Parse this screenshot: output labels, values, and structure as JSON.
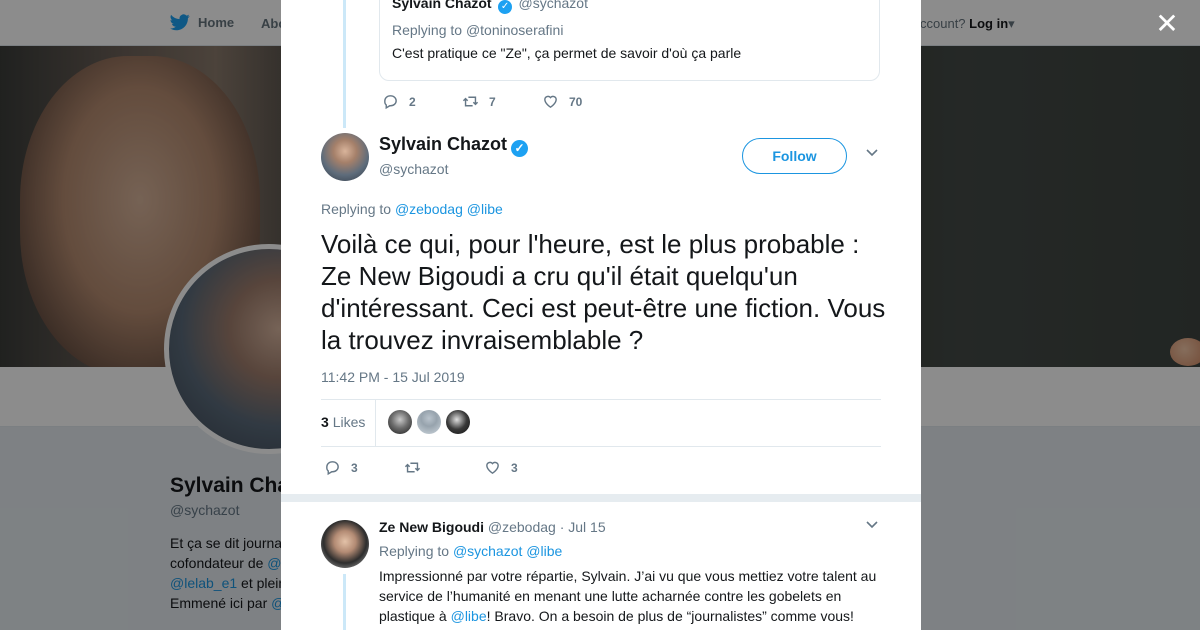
{
  "nav": {
    "home_label": "Home",
    "about_label": "Abo",
    "account_text": "ccount?",
    "login_label": "Log in"
  },
  "profile": {
    "name": "Sylvain Cha",
    "handle": "@sychazot",
    "bio_line1": "Et ça se dit journa",
    "bio_line2a": "cofondateur de ",
    "bio_line2b": "@",
    "bio_line3a": "@lelab_e1",
    "bio_line3b": " et plein",
    "bio_line4a": "Emmené ici par ",
    "bio_line4b": "@"
  },
  "quoted": {
    "name": "Sylvain Chazot",
    "handle": "@sychazot",
    "replying_prefix": "Replying to ",
    "replying_to": "@toninoserafini",
    "text": "C'est pratique ce \"Ze\", ça permet de savoir d'où ça parle",
    "replies": "2",
    "retweets": "7",
    "likes": "70"
  },
  "main": {
    "name": "Sylvain Chazot",
    "handle": "@sychazot",
    "follow_label": "Follow",
    "replying_prefix": "Replying to ",
    "replying_to_1": "@zebodag",
    "replying_to_2": "@libe",
    "text": "Voilà ce qui, pour l'heure, est le plus probable : Ze New Bigoudi a cru qu'il était quelqu'un d'intéressant. Ceci est peut-être une fiction. Vous la trouvez invraisemblable ?",
    "timestamp": "11:42 PM - 15 Jul 2019",
    "likes_count": "3",
    "likes_label": "Likes",
    "replies": "3",
    "retweets": "",
    "likes": "3"
  },
  "reply": {
    "name": "Ze New Bigoudi",
    "handle": "@zebodag",
    "date": "· Jul 15",
    "replying_prefix": "Replying to ",
    "replying_to_1": "@sychazot",
    "replying_to_2": "@libe",
    "text_1": "Impressionné par votre répartie, Sylvain. J’ai vu que vous mettiez votre talent au service de l’humanité en menant une lutte acharnée contre les gobelets en plastique à ",
    "text_link": "@libe",
    "text_2": "! Bravo. On a besoin de plus de “journalistes” comme vous!"
  },
  "colors": {
    "accent": "#1b95e0",
    "verified": "#1da1f2",
    "thread": "#cce8f8"
  },
  "icons": {
    "close": "close-icon",
    "reply": "reply-icon",
    "retweet": "retweet-icon",
    "like": "heart-icon",
    "caret": "chevron-down-icon",
    "logo": "twitter-bird-icon"
  }
}
